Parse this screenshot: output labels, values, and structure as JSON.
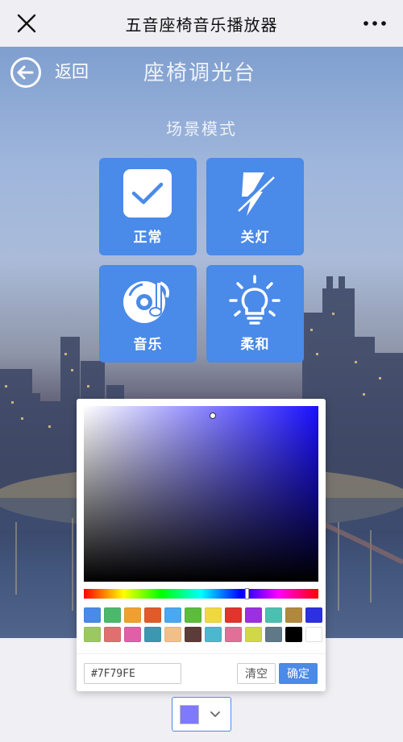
{
  "topbar": {
    "title": "五音座椅音乐播放器",
    "close_icon": "close-icon",
    "more_icon": "more-icon"
  },
  "header": {
    "back_label": "返回",
    "page_title": "座椅调光台",
    "back_icon": "arrow-left-icon"
  },
  "scene_mode": {
    "heading": "场景模式",
    "modes": [
      {
        "label": "正常",
        "icon": "check-icon"
      },
      {
        "label": "关灯",
        "icon": "lightning-off-icon"
      },
      {
        "label": "音乐",
        "icon": "music-disc-icon"
      },
      {
        "label": "柔和",
        "icon": "lightbulb-icon"
      }
    ]
  },
  "color_picker": {
    "hex_value": "#7F79FE",
    "clear_label": "清空",
    "confirm_label": "确定",
    "swatches": [
      "#4a8ae8",
      "#4cb86c",
      "#f0a030",
      "#e05a2a",
      "#4aa8f0",
      "#5cbc3c",
      "#f0d840",
      "#e0342c",
      "#9a30e0",
      "#4cc0b0",
      "#b08840",
      "#2c30e0",
      "#9cc860",
      "#e07070",
      "#e060a8",
      "#3c98b0",
      "#f0c088",
      "#5c3c38",
      "#4cb8d0",
      "#e07098",
      "#d0d848",
      "#607888",
      "#000000",
      "#ffffff"
    ]
  },
  "selected_color": "#7f79fe",
  "colors": {
    "accent": "#4a8ae8"
  }
}
